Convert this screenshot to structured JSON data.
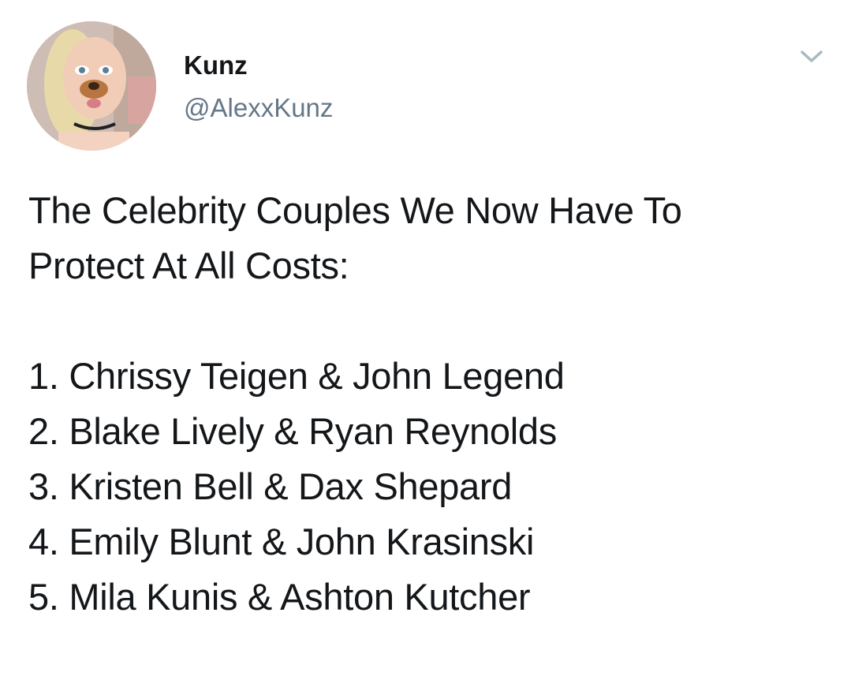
{
  "tweet": {
    "display_name": "Kunz",
    "handle": "@AlexxKunz",
    "avatar_icon": "profile-photo-dog-filter",
    "menu_icon": "chevron-down-icon",
    "headline_line1": "The Celebrity Couples We Now Have To",
    "headline_line2": "Protect At All Costs:",
    "list": [
      "1. Chrissy Teigen & John Legend",
      "2. Blake Lively & Ryan Reynolds",
      "3. Kristen Bell & Dax Shepard",
      "4. Emily Blunt & John Krasinski",
      "5. Mila Kunis & Ashton Kutcher"
    ]
  },
  "colors": {
    "text": "#14171a",
    "secondary_text": "#657786",
    "chevron": "#aab8c2",
    "background": "#ffffff"
  }
}
